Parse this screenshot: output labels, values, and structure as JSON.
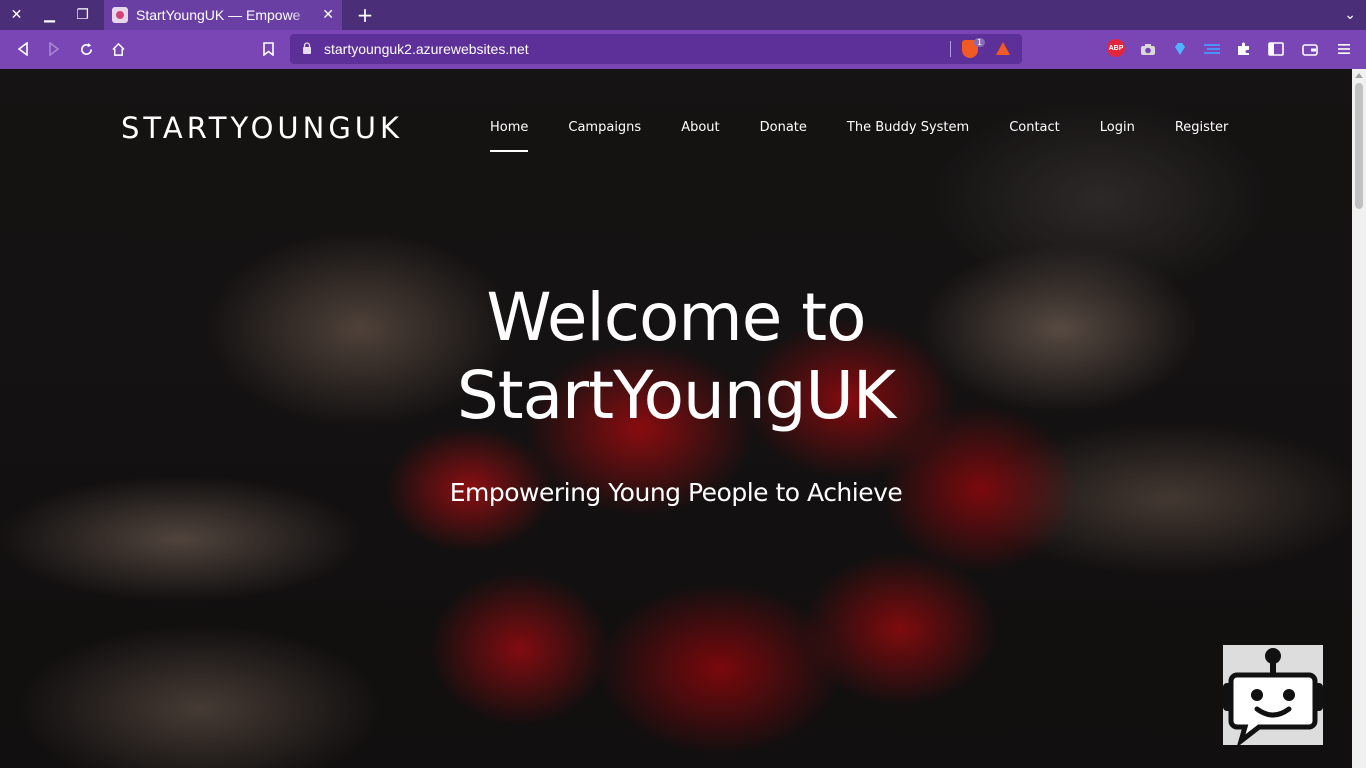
{
  "browser": {
    "tab_title": "StartYoungUK — Empowe",
    "url": "startyounguk2.azurewebsites.net",
    "shield_count": "1",
    "abp_label": "ABP",
    "icons": {
      "close": "close-icon",
      "minimize": "minimize-icon",
      "restore": "restore-icon",
      "back": "back-icon",
      "forward": "forward-icon",
      "reload": "reload-icon",
      "home": "home-icon",
      "bookmark": "bookmark-icon",
      "lock": "lock-icon",
      "extensions": "puzzle-icon",
      "sidebar": "sidebar-icon",
      "wallet": "wallet-icon",
      "menu": "hamburger-icon"
    }
  },
  "site": {
    "brand": "STARTYOUNGUK",
    "nav": [
      {
        "label": "Home",
        "active": true
      },
      {
        "label": "Campaigns"
      },
      {
        "label": "About"
      },
      {
        "label": "Donate"
      },
      {
        "label": "The Buddy System"
      },
      {
        "label": "Contact"
      },
      {
        "label": "Login"
      },
      {
        "label": "Register"
      }
    ],
    "hero": {
      "title_line1": "Welcome to",
      "title_line2": "StartYoungUK",
      "subtitle": "Empowering Young People to Achieve"
    }
  },
  "colors": {
    "tabbar": "#4a2f78",
    "toolbar": "#7a45b4",
    "urlbar": "#5d2f99",
    "accent_red": "#c41418"
  }
}
